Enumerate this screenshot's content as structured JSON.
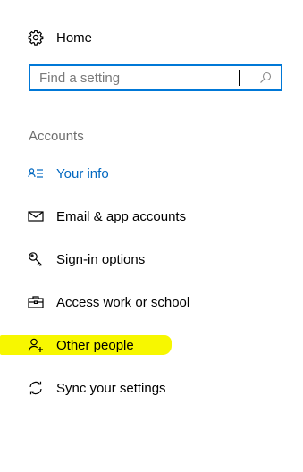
{
  "home": {
    "label": "Home",
    "icon": "gear-icon"
  },
  "search": {
    "placeholder": "Find a setting",
    "value": "",
    "icon": "search-icon"
  },
  "section": {
    "title": "Accounts"
  },
  "nav": {
    "items": [
      {
        "label": "Your info",
        "icon": "contact-card-icon",
        "active": true
      },
      {
        "label": "Email & app accounts",
        "icon": "envelope-icon",
        "active": false
      },
      {
        "label": "Sign-in options",
        "icon": "key-icon",
        "active": false
      },
      {
        "label": "Access work or school",
        "icon": "briefcase-icon",
        "active": false
      },
      {
        "label": "Other people",
        "icon": "add-person-icon",
        "active": false
      },
      {
        "label": "Sync your settings",
        "icon": "sync-icon",
        "active": false
      }
    ]
  },
  "colors": {
    "accent": "#0078d7",
    "active_text": "#0067c0",
    "highlight": "#f7f700",
    "section_title": "#6d6d6d"
  }
}
